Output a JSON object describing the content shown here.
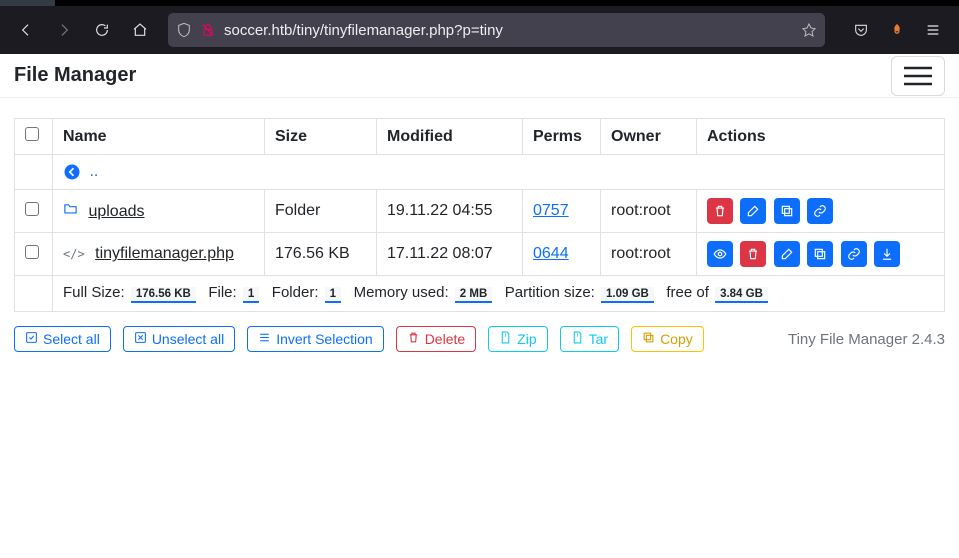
{
  "browser": {
    "url": "soccer.htb/tiny/tinyfilemanager.php?p=tiny"
  },
  "header": {
    "brand": "File Manager"
  },
  "table": {
    "columns": {
      "name": "Name",
      "size": "Size",
      "modified": "Modified",
      "perms": "Perms",
      "owner": "Owner",
      "actions": "Actions"
    },
    "parent_label": "..",
    "rows": [
      {
        "icon": "folder",
        "name": "uploads",
        "size": "Folder",
        "modified": "19.11.22 04:55",
        "perms": "0757",
        "owner": "root:root",
        "actions": [
          "delete",
          "rename",
          "copy",
          "link"
        ]
      },
      {
        "icon": "code",
        "name": "tinyfilemanager.php",
        "size": "176.56 KB",
        "modified": "17.11.22 08:07",
        "perms": "0644",
        "owner": "root:root",
        "actions": [
          "view",
          "delete",
          "rename",
          "copy",
          "link",
          "download"
        ]
      }
    ],
    "summary": {
      "full_size_label": "Full Size:",
      "full_size": "176.56 KB",
      "file_label": "File:",
      "file_count": "1",
      "folder_label": "Folder:",
      "folder_count": "1",
      "memory_label": "Memory used:",
      "memory": "2 MB",
      "partition_label": "Partition size:",
      "partition": "1.09 GB",
      "free_label": "free of",
      "total": "3.84 GB"
    }
  },
  "buttons": {
    "select_all": "Select all",
    "unselect_all": "Unselect all",
    "invert": "Invert Selection",
    "delete": "Delete",
    "zip": "Zip",
    "tar": "Tar",
    "copy": "Copy"
  },
  "footer": {
    "note": "Tiny File Manager 2.4.3"
  }
}
